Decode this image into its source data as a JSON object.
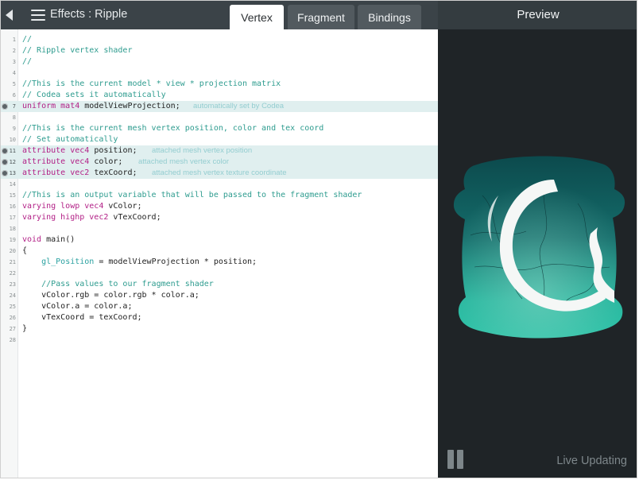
{
  "header": {
    "title": "Effects : Ripple",
    "tabs": [
      {
        "label": "Vertex",
        "active": true
      },
      {
        "label": "Fragment",
        "active": false
      },
      {
        "label": "Bindings",
        "active": false
      }
    ]
  },
  "preview": {
    "title": "Preview",
    "status": "Live Updating"
  },
  "editor": {
    "lines": [
      {
        "n": "1",
        "parts": [
          {
            "t": "//",
            "c": "c"
          }
        ]
      },
      {
        "n": "2",
        "parts": [
          {
            "t": "// Ripple vertex shader",
            "c": "c"
          }
        ]
      },
      {
        "n": "3",
        "parts": [
          {
            "t": "//",
            "c": "c"
          }
        ]
      },
      {
        "n": "4",
        "parts": []
      },
      {
        "n": "5",
        "parts": [
          {
            "t": "//This is the current model * view * projection matrix",
            "c": "c"
          }
        ]
      },
      {
        "n": "6",
        "parts": [
          {
            "t": "// Codea sets it automatically",
            "c": "c"
          }
        ]
      },
      {
        "n": "7",
        "hl": true,
        "bp": true,
        "hint": "automatically set by Codea",
        "parts": [
          {
            "t": "uniform mat4",
            "c": "k"
          },
          {
            "t": " modelViewProjection;",
            "c": ""
          }
        ]
      },
      {
        "n": "8",
        "parts": []
      },
      {
        "n": "9",
        "parts": [
          {
            "t": "//This is the current mesh vertex position, color and tex coord",
            "c": "c"
          }
        ]
      },
      {
        "n": "10",
        "parts": [
          {
            "t": "// Set automatically",
            "c": "c"
          }
        ]
      },
      {
        "n": "11",
        "hl": true,
        "bp": true,
        "hint": "attached mesh vertex position",
        "parts": [
          {
            "t": "attribute vec4",
            "c": "k"
          },
          {
            "t": " position;",
            "c": ""
          }
        ]
      },
      {
        "n": "12",
        "hl": true,
        "bp": true,
        "hint": "attached mesh vertex color",
        "parts": [
          {
            "t": "attribute vec4",
            "c": "k"
          },
          {
            "t": " color;",
            "c": ""
          }
        ]
      },
      {
        "n": "13",
        "hl": true,
        "bp": true,
        "hint": "attached mesh vertex texture coordinate",
        "parts": [
          {
            "t": "attribute vec2",
            "c": "k"
          },
          {
            "t": " texCoord;",
            "c": ""
          }
        ]
      },
      {
        "n": "14",
        "parts": []
      },
      {
        "n": "15",
        "parts": [
          {
            "t": "//This is an output variable that will be passed to the fragment shader",
            "c": "c"
          }
        ]
      },
      {
        "n": "16",
        "parts": [
          {
            "t": "varying lowp vec4",
            "c": "k"
          },
          {
            "t": " vColor;",
            "c": ""
          }
        ]
      },
      {
        "n": "17",
        "parts": [
          {
            "t": "varying highp vec2",
            "c": "k"
          },
          {
            "t": " vTexCoord;",
            "c": ""
          }
        ]
      },
      {
        "n": "18",
        "parts": []
      },
      {
        "n": "19",
        "parts": [
          {
            "t": "void",
            "c": "k"
          },
          {
            "t": " main()",
            "c": ""
          }
        ]
      },
      {
        "n": "20",
        "parts": [
          {
            "t": "{",
            "c": ""
          }
        ]
      },
      {
        "n": "21",
        "parts": [
          {
            "t": "    ",
            "c": ""
          },
          {
            "t": "gl_Position",
            "c": "f"
          },
          {
            "t": " = modelViewProjection * position;",
            "c": ""
          }
        ]
      },
      {
        "n": "22",
        "parts": []
      },
      {
        "n": "23",
        "parts": [
          {
            "t": "    //Pass values to our fragment shader",
            "c": "c"
          }
        ]
      },
      {
        "n": "24",
        "parts": [
          {
            "t": "    vColor.rgb = color.rgb * color.a;",
            "c": ""
          }
        ]
      },
      {
        "n": "25",
        "parts": [
          {
            "t": "    vColor.a = color.a;",
            "c": ""
          }
        ]
      },
      {
        "n": "26",
        "parts": [
          {
            "t": "    vTexCoord = texCoord;",
            "c": ""
          }
        ]
      },
      {
        "n": "27",
        "parts": [
          {
            "t": "}",
            "c": ""
          }
        ]
      },
      {
        "n": "28",
        "parts": []
      }
    ]
  },
  "icons": {
    "back": "back-arrow-icon",
    "menu": "hamburger-menu-icon",
    "breakpoint": "breakpoint-icon",
    "pause": "pause-icon",
    "logo": "codea-logo"
  },
  "colors": {
    "topbar": "#3b4348",
    "comment": "#2e9c8f",
    "keyword": "#b21f86",
    "builtin": "#2aa1a0",
    "highlight_row": "#e0efef",
    "hint": "#93cdd0",
    "preview_bg": "#1f2427"
  }
}
